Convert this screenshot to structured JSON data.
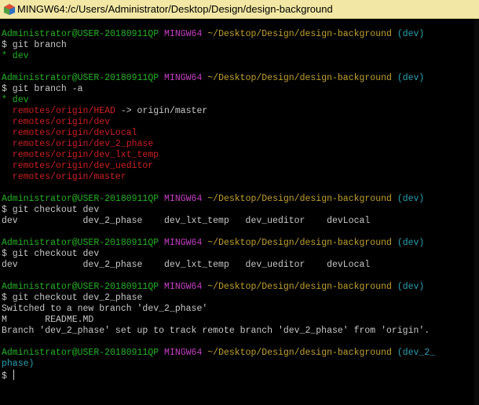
{
  "window": {
    "title": "MINGW64:/c/Users/Administrator/Desktop/Design/design-background"
  },
  "prompt": {
    "user": "Administrator@USER-20180911QP",
    "env": "MINGW64",
    "path": "~/Desktop/Design/design-background",
    "branch_dev": "(dev)",
    "branch_phase_a": "(dev_2_",
    "branch_phase_b": "phase)"
  },
  "commands": {
    "git_branch": "$ git branch",
    "git_branch_a": "$ git branch -a",
    "git_checkout_dev_1": "$ git checkout dev",
    "git_checkout_dev_2": "$ git checkout dev",
    "git_checkout_phase": "$ git checkout dev_2_phase",
    "final_prompt": "$ "
  },
  "output": {
    "local_current": "* dev",
    "all_current": "* dev",
    "remotes": [
      "  remotes/origin/HEAD",
      "  remotes/origin/dev",
      "  remotes/origin/devLocal",
      "  remotes/origin/dev_2_phase",
      "  remotes/origin/dev_lxt_temp",
      "  remotes/origin/dev_ueditor",
      "  remotes/origin/master"
    ],
    "head_arrow": " -> origin/master",
    "completion_list_1": "dev            dev_2_phase    dev_lxt_temp   dev_ueditor    devLocal",
    "completion_list_2": "dev            dev_2_phase    dev_lxt_temp   dev_ueditor    devLocal",
    "switched": "Switched to a new branch 'dev_2_phase'",
    "modified": "M       README.MD",
    "tracking": "Branch 'dev_2_phase' set up to track remote branch 'dev_2_phase' from 'origin'."
  }
}
